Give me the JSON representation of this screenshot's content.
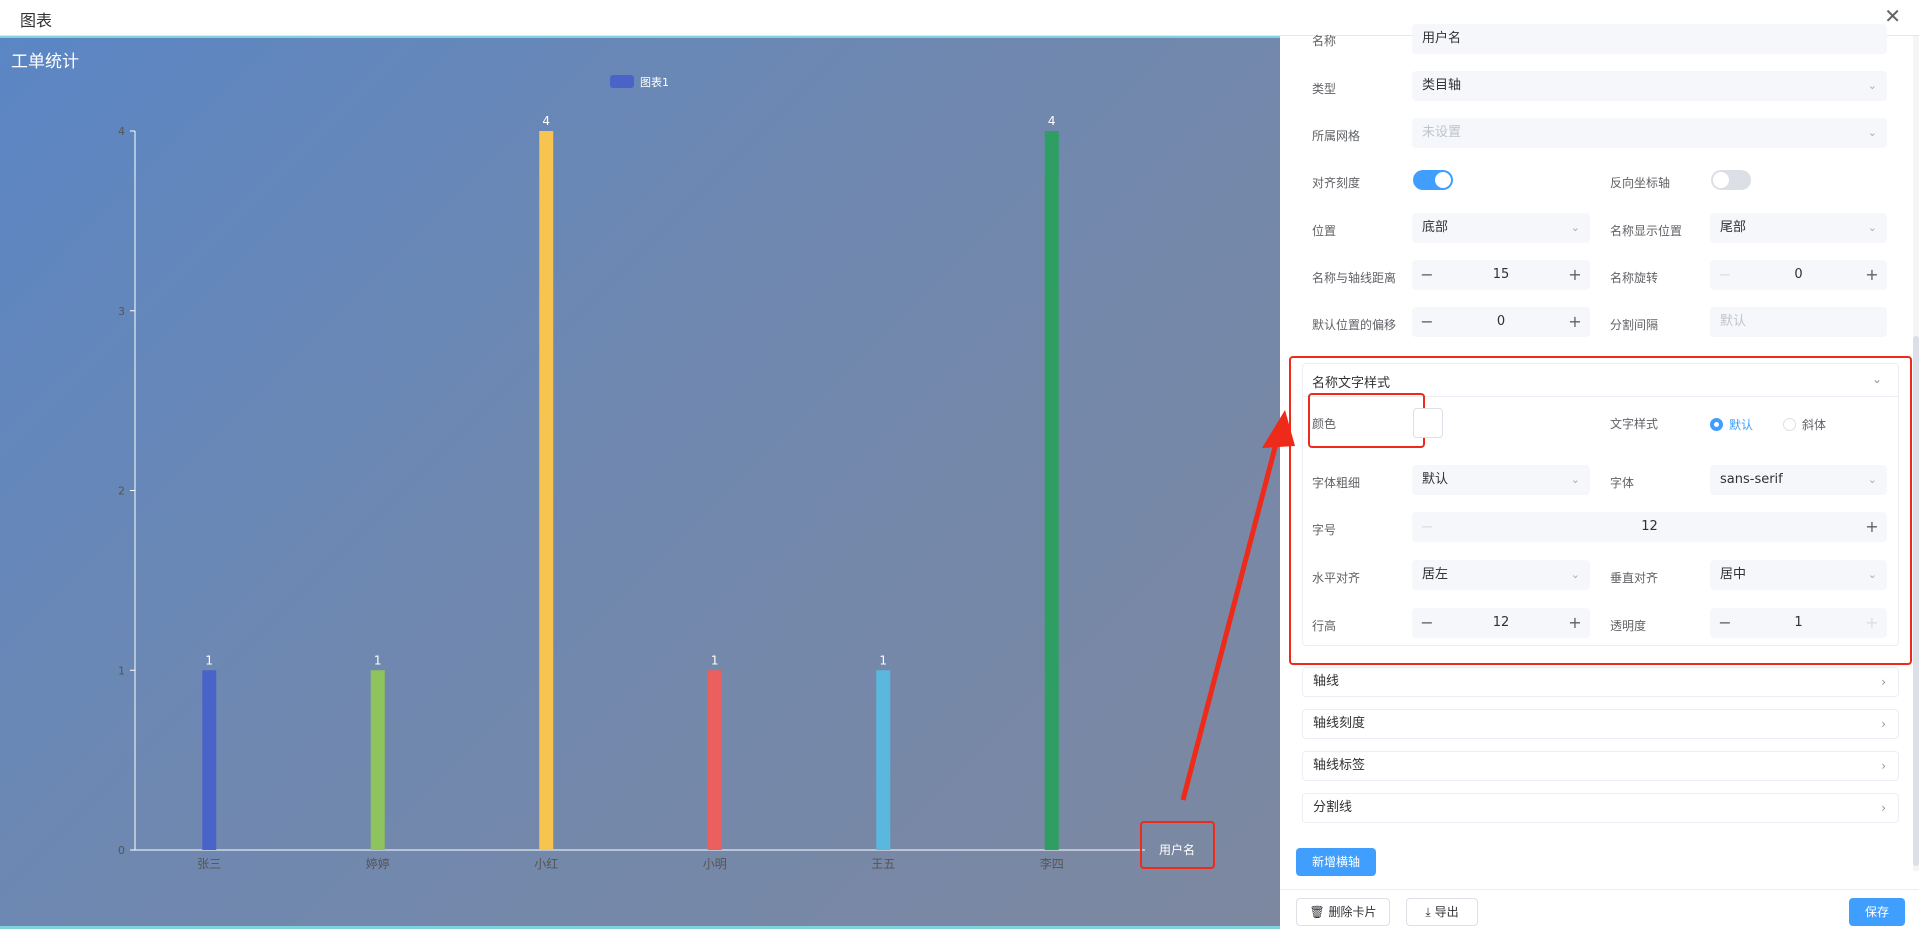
{
  "window": {
    "title": "图表",
    "close_icon": "close-icon"
  },
  "chart_data": {
    "type": "bar",
    "title": "工单统计",
    "legend": [
      "图表1"
    ],
    "legend_position": "top-center",
    "categories": [
      "张三",
      "婷婷",
      "小红",
      "小明",
      "王五",
      "李四"
    ],
    "values": [
      1,
      1,
      4,
      1,
      1,
      4
    ],
    "colors": [
      "#4a63c8",
      "#8fc35e",
      "#f7c44f",
      "#ec5f5f",
      "#5ab8de",
      "#2f9e63"
    ],
    "xlabel": "用户名",
    "ylabel": "",
    "ylim": [
      0,
      4
    ],
    "yticks": [
      "0",
      "1",
      "2",
      "3",
      "4"
    ],
    "data_labels": [
      "1",
      "1",
      "4",
      "1",
      "1",
      "4"
    ]
  },
  "panel": {
    "name": {
      "label": "名称",
      "value": "用户名"
    },
    "type": {
      "label": "类型",
      "value": "类目轴"
    },
    "grid": {
      "label": "所属网格",
      "placeholder": "未设置"
    },
    "align_ticks": {
      "label": "对齐刻度",
      "on": true
    },
    "reverse_axis": {
      "label": "反向坐标轴",
      "on": false
    },
    "position": {
      "label": "位置",
      "value": "底部"
    },
    "name_position": {
      "label": "名称显示位置",
      "value": "尾部"
    },
    "name_gap": {
      "label": "名称与轴线距离",
      "value": "15"
    },
    "name_rotate": {
      "label": "名称旋转",
      "value": "0"
    },
    "offset": {
      "label": "默认位置的偏移",
      "value": "0"
    },
    "split_interval": {
      "label": "分割间隔",
      "placeholder": "默认"
    },
    "name_text_style": {
      "title": "名称文字样式",
      "color": {
        "label": "颜色",
        "value": "#ffffff"
      },
      "font_style": {
        "label": "文字样式",
        "options": [
          "默认",
          "斜体"
        ],
        "selected": "默认"
      },
      "font_weight": {
        "label": "字体粗细",
        "value": "默认"
      },
      "font_family": {
        "label": "字体",
        "value": "sans-serif"
      },
      "font_size": {
        "label": "字号",
        "value": "12"
      },
      "align": {
        "label": "水平对齐",
        "value": "居左"
      },
      "vertical_align": {
        "label": "垂直对齐",
        "value": "居中"
      },
      "line_height": {
        "label": "行高",
        "value": "12"
      },
      "opacity": {
        "label": "透明度",
        "value": "1"
      }
    },
    "collapses": [
      "轴线",
      "轴线刻度",
      "轴线标签",
      "分割线"
    ],
    "add_axis": "新增横轴"
  },
  "footer": {
    "delete": "删除卡片",
    "export": "导出",
    "save": "保存"
  }
}
